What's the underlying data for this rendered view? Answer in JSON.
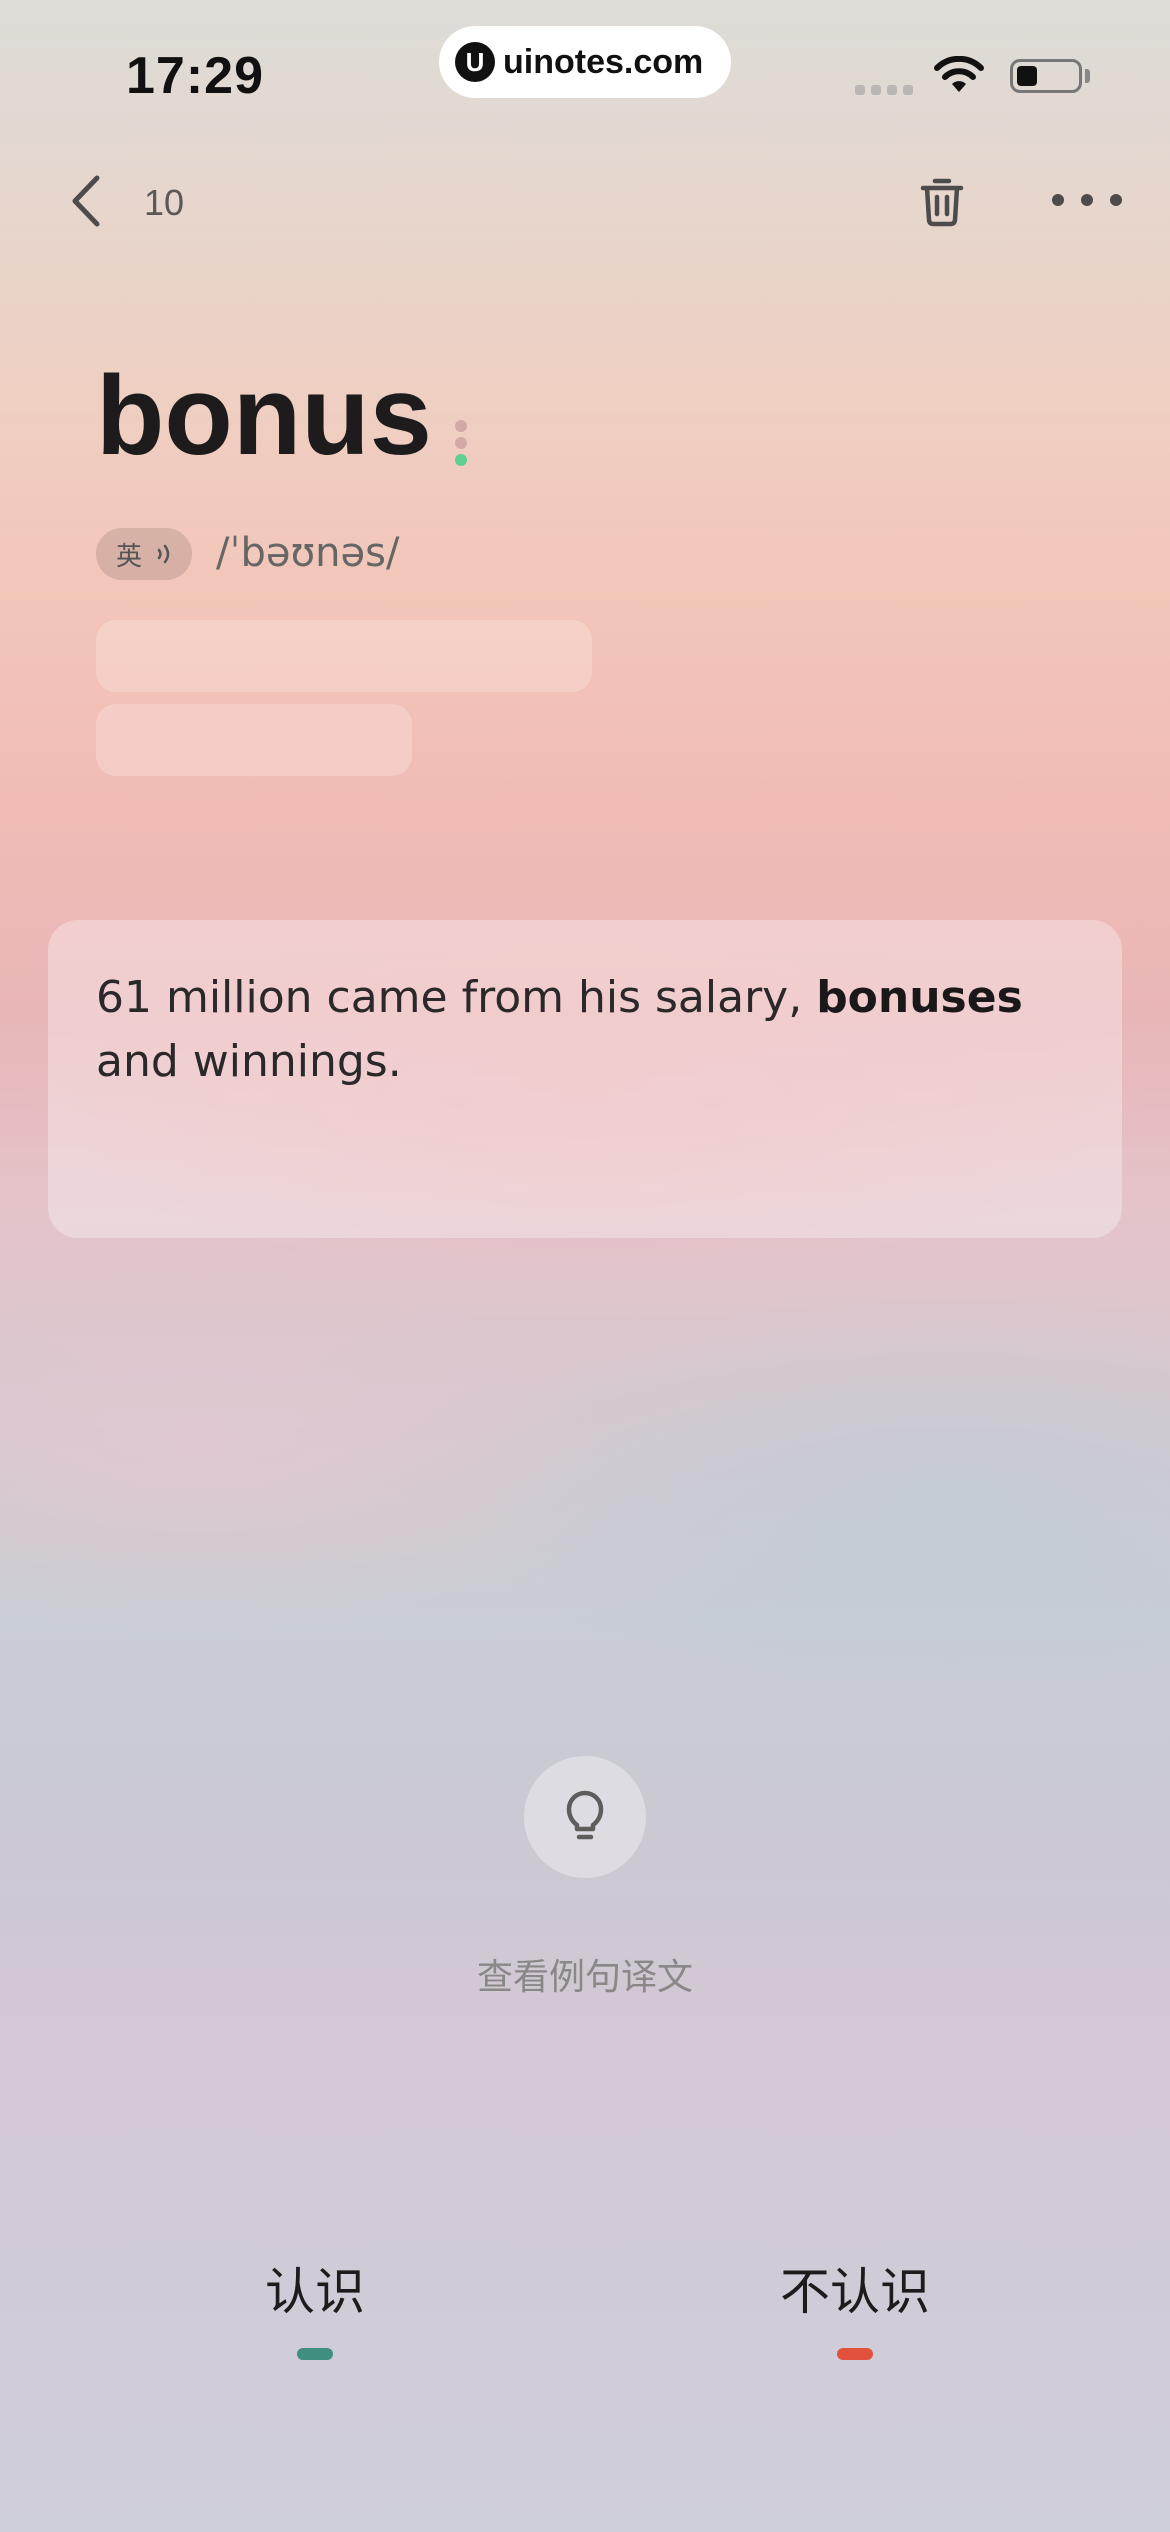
{
  "status_bar": {
    "time": "17:29",
    "watermark": "uinotes.com"
  },
  "nav": {
    "counter": "10",
    "icons": [
      "chevron-left-icon",
      "trash-icon",
      "more-horizontal-icon"
    ]
  },
  "word": {
    "text": "bonus",
    "language_tag": "英",
    "phonetic": "/ˈbəʊnəs/",
    "level_dot_colors": [
      "#d3a9a5",
      "#d3a9a5",
      "#5fcf92"
    ]
  },
  "example": {
    "before": "61 million came from his salary, ",
    "highlight": "bonuses",
    "after": " and winnings."
  },
  "hint": {
    "icon": "lightbulb-icon",
    "label": "查看例句译文"
  },
  "choices": {
    "know": {
      "label": "认识",
      "color": "#3f8e7e"
    },
    "unknown": {
      "label": "不认识",
      "color": "#e2513b"
    }
  }
}
